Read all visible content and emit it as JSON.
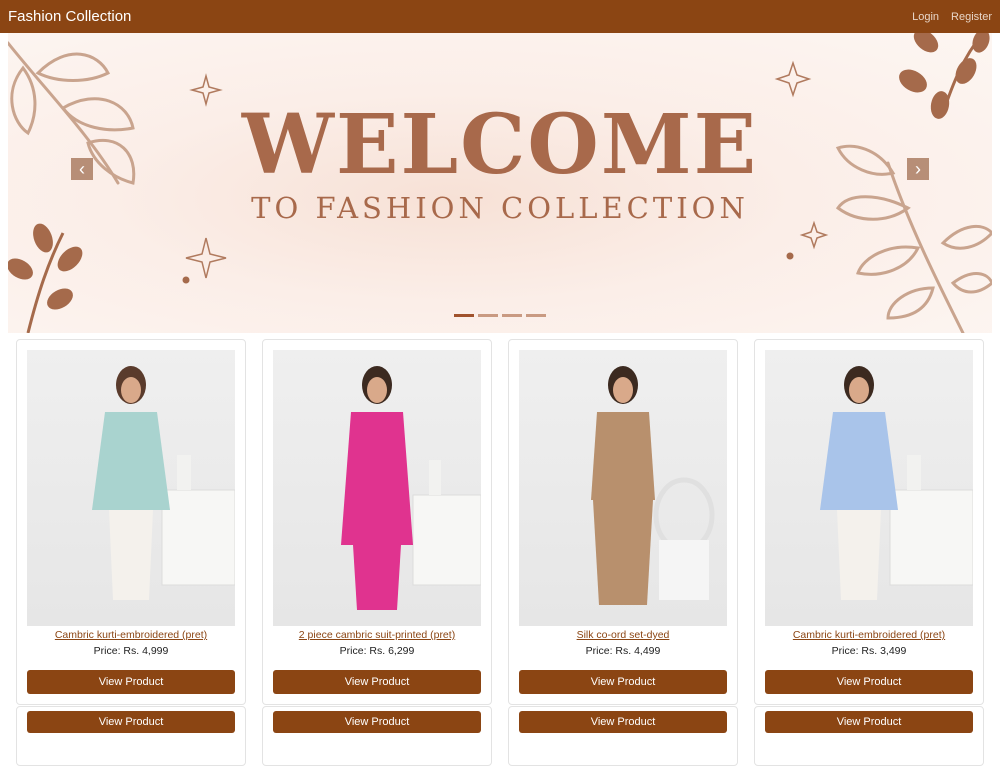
{
  "navbar": {
    "brand": "Fashion Collection",
    "links": [
      "Login",
      "Register"
    ]
  },
  "carousel": {
    "heading": "WELCOME",
    "subheading": "TO FASHION COLLECTION",
    "prev_icon": "chevron-left-icon",
    "next_icon": "chevron-right-icon",
    "indicator_count": 4,
    "active_index": 0
  },
  "products": [
    {
      "name": "Cambric kurti-embroidered (pret)",
      "price": "Price: Rs. 4,999",
      "button": "View Product",
      "top_color": "#a9d3cf",
      "bottom_color": "#f4f1ec"
    },
    {
      "name": "2 piece cambric suit-printed (pret)",
      "price": "Price: Rs. 6,299",
      "button": "View Product",
      "top_color": "#e0338f",
      "bottom_color": "#e0338f"
    },
    {
      "name": "Silk co-ord set-dyed",
      "price": "Price: Rs. 4,499",
      "button": "View Product",
      "top_color": "#b8906d",
      "bottom_color": "#b8906d"
    },
    {
      "name": "Cambric kurti-embroidered (pret)",
      "price": "Price: Rs. 3,499",
      "button": "View Product",
      "top_color": "#a9c4ea",
      "bottom_color": "#f4f1ec"
    }
  ],
  "second_row": [
    {
      "button": "View Product"
    },
    {
      "button": "View Product"
    },
    {
      "button": "View Product"
    },
    {
      "button": "View Product"
    }
  ],
  "colors": {
    "brand": "#8b4513",
    "accent_text": "#a8694b"
  }
}
